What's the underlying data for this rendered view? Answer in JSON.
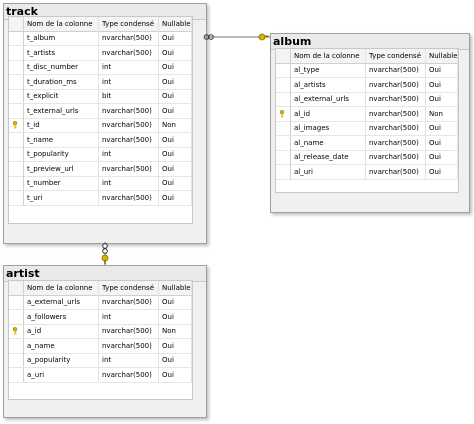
{
  "columns_header": {
    "name": "Nom de la colonne",
    "type": "Type condensé",
    "nullable": "Nullable"
  },
  "track": {
    "title": "track",
    "rows": [
      {
        "name": "t_album",
        "type": "nvarchar(500)",
        "nullable": "Oui",
        "pk": false
      },
      {
        "name": "t_artists",
        "type": "nvarchar(500)",
        "nullable": "Oui",
        "pk": false
      },
      {
        "name": "t_disc_number",
        "type": "int",
        "nullable": "Oui",
        "pk": false
      },
      {
        "name": "t_duration_ms",
        "type": "int",
        "nullable": "Oui",
        "pk": false
      },
      {
        "name": "t_explicit",
        "type": "bit",
        "nullable": "Oui",
        "pk": false
      },
      {
        "name": "t_external_urls",
        "type": "nvarchar(500)",
        "nullable": "Oui",
        "pk": false
      },
      {
        "name": "t_id",
        "type": "nvarchar(500)",
        "nullable": "Non",
        "pk": true
      },
      {
        "name": "t_name",
        "type": "nvarchar(500)",
        "nullable": "Oui",
        "pk": false
      },
      {
        "name": "t_popularity",
        "type": "int",
        "nullable": "Oui",
        "pk": false
      },
      {
        "name": "t_preview_url",
        "type": "nvarchar(500)",
        "nullable": "Oui",
        "pk": false
      },
      {
        "name": "t_number",
        "type": "int",
        "nullable": "Oui",
        "pk": false
      },
      {
        "name": "t_uri",
        "type": "nvarchar(500)",
        "nullable": "Oui",
        "pk": false
      }
    ]
  },
  "album": {
    "title": "album",
    "rows": [
      {
        "name": "al_type",
        "type": "nvarchar(500)",
        "nullable": "Oui",
        "pk": false
      },
      {
        "name": "al_artists",
        "type": "nvarchar(500)",
        "nullable": "Oui",
        "pk": false
      },
      {
        "name": "al_external_urls",
        "type": "nvarchar(500)",
        "nullable": "Oui",
        "pk": false
      },
      {
        "name": "al_id",
        "type": "nvarchar(500)",
        "nullable": "Non",
        "pk": true
      },
      {
        "name": "al_images",
        "type": "nvarchar(500)",
        "nullable": "Oui",
        "pk": false
      },
      {
        "name": "al_name",
        "type": "nvarchar(500)",
        "nullable": "Oui",
        "pk": false
      },
      {
        "name": "al_release_date",
        "type": "nvarchar(500)",
        "nullable": "Oui",
        "pk": false
      },
      {
        "name": "al_uri",
        "type": "nvarchar(500)",
        "nullable": "Oui",
        "pk": false
      }
    ]
  },
  "artist": {
    "title": "artist",
    "rows": [
      {
        "name": "a_external_urls",
        "type": "nvarchar(500)",
        "nullable": "Oui",
        "pk": false
      },
      {
        "name": "a_followers",
        "type": "int",
        "nullable": "Oui",
        "pk": false
      },
      {
        "name": "a_id",
        "type": "nvarchar(500)",
        "nullable": "Non",
        "pk": true
      },
      {
        "name": "a_name",
        "type": "nvarchar(500)",
        "nullable": "Oui",
        "pk": false
      },
      {
        "name": "a_popularity",
        "type": "int",
        "nullable": "Oui",
        "pk": false
      },
      {
        "name": "a_uri",
        "type": "nvarchar(500)",
        "nullable": "Oui",
        "pk": false
      }
    ]
  },
  "colors": {
    "key": "#d9b400",
    "connector": "#707070"
  },
  "icons": {
    "primary_key": "key-icon",
    "relationship_end": "relationship-infinity-icon",
    "relationship_one": "relationship-key-icon"
  }
}
